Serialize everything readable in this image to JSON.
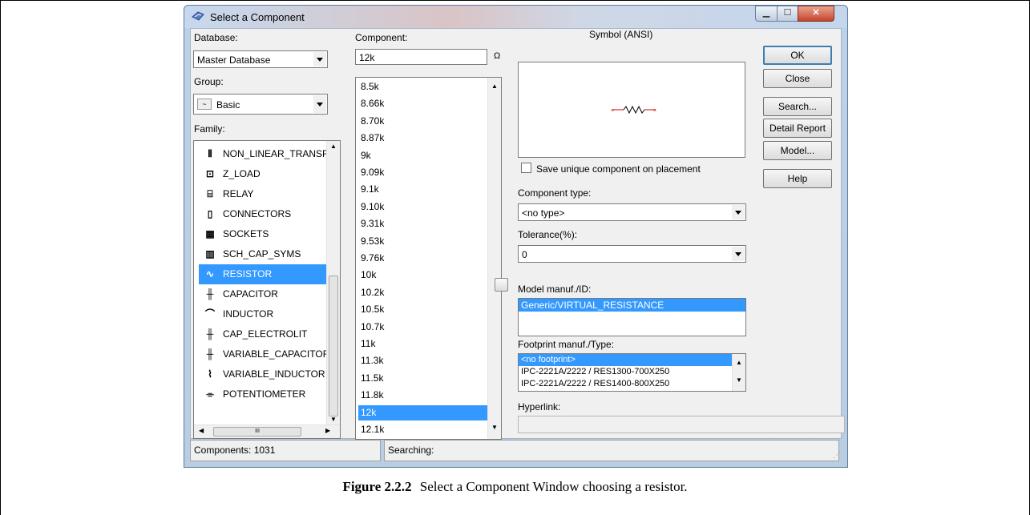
{
  "window": {
    "title": "Select a Component"
  },
  "labels": {
    "database": "Database:",
    "group": "Group:",
    "family": "Family:",
    "component": "Component:",
    "symbol": "Symbol (ANSI)",
    "component_type": "Component type:",
    "tolerance": "Tolerance(%):",
    "model_manuf": "Model manuf./ID:",
    "footprint_manuf": "Footprint manuf./Type:",
    "hyperlink": "Hyperlink:",
    "save_unique": "Save unique component on placement",
    "ohm": "Ω"
  },
  "database": {
    "value": "Master Database"
  },
  "group": {
    "value": "Basic"
  },
  "component_field": {
    "value": "12k"
  },
  "component_type": {
    "value": "<no type>"
  },
  "tolerance": {
    "value": "0"
  },
  "families": [
    {
      "label": "NON_LINEAR_TRANSF",
      "icon": "transformer-icon"
    },
    {
      "label": "Z_LOAD",
      "icon": "z-load-icon"
    },
    {
      "label": "RELAY",
      "icon": "relay-icon"
    },
    {
      "label": "CONNECTORS",
      "icon": "connector-icon"
    },
    {
      "label": "SOCKETS",
      "icon": "socket-icon"
    },
    {
      "label": "SCH_CAP_SYMS",
      "icon": "sch-cap-icon"
    },
    {
      "label": "RESISTOR",
      "icon": "resistor-icon",
      "selected": true
    },
    {
      "label": "CAPACITOR",
      "icon": "capacitor-icon"
    },
    {
      "label": "INDUCTOR",
      "icon": "inductor-icon"
    },
    {
      "label": "CAP_ELECTROLIT",
      "icon": "electrolytic-cap-icon"
    },
    {
      "label": "VARIABLE_CAPACITOF",
      "icon": "variable-capacitor-icon"
    },
    {
      "label": "VARIABLE_INDUCTOR",
      "icon": "variable-inductor-icon"
    },
    {
      "label": "POTENTIOMETER",
      "icon": "potentiometer-icon"
    }
  ],
  "components": [
    "8.5k",
    "8.66k",
    "8.70k",
    "8.87k",
    "9k",
    "9.09k",
    "9.1k",
    "9.10k",
    "9.31k",
    "9.53k",
    "9.76k",
    "10k",
    "10.2k",
    "10.5k",
    "10.7k",
    "11k",
    "11.3k",
    "11.5k",
    "11.8k",
    "12k",
    "12.1k"
  ],
  "selected_component": "12k",
  "model_ids": [
    "Generic/VIRTUAL_RESISTANCE"
  ],
  "footprints": [
    "<no footprint>",
    "IPC-2221A/2222 / RES1300-700X250",
    "IPC-2221A/2222 / RES1400-800X250"
  ],
  "buttons": {
    "ok": "OK",
    "close": "Close",
    "search": "Search...",
    "detail": "Detail Report",
    "model": "Model...",
    "help": "Help"
  },
  "status": {
    "components": "Components: 1031",
    "searching": "Searching:"
  },
  "scroll": {
    "hscroll_mark": "III"
  },
  "caption": {
    "label": "Figure 2.2.2",
    "text": "Select a Component Window choosing a resistor."
  },
  "colors": {
    "selection": "#3399ff",
    "resistor_symbol": "#cc0000"
  }
}
